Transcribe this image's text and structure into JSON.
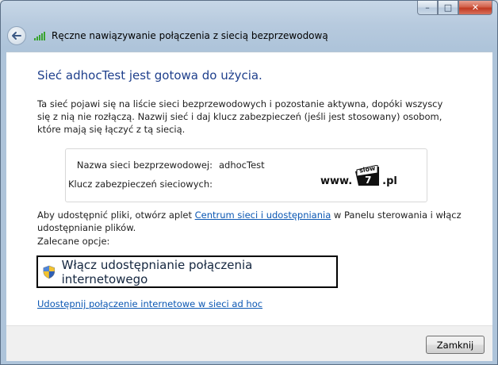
{
  "window": {
    "title": "Ręczne nawiązywanie połączenia z siecią bezprzewodową",
    "minimize_glyph": "–",
    "maximize_glyph": "□",
    "close_glyph": "✕"
  },
  "icons": {
    "back": "back-arrow-icon",
    "network": "wireless-signal-icon",
    "shield": "uac-shield-icon"
  },
  "main": {
    "heading": "Sieć adhocTest jest gotowa do użycia.",
    "description": "Ta sieć pojawi się na liście sieci bezprzewodowych i pozostanie aktywna, dopóki wszyscy się z nią nie rozłączą. Nazwij sieć i daj klucz zabezpieczeń (jeśli jest stosowany) osobom, które mają się łączyć z tą siecią.",
    "network_name_label": "Nazwa sieci bezprzewodowej:",
    "network_name_value": "adhocTest",
    "security_key_label": "Klucz zabezpieczeń sieciowych:",
    "security_key_value": "",
    "share_text_before": "Aby udostępnić pliki, otwórz aplet ",
    "share_link": "Centrum sieci i udostępniania",
    "share_text_after": " w Panelu sterowania i włącz udostępnianie plików.",
    "recommended_label": "Zalecane opcje:",
    "ics_option": "Włącz udostępnianie połączenia internetowego",
    "adhoc_link": "Udostępnij połączenie internetowe w sieci ad hoc"
  },
  "watermark": {
    "prefix": "www.",
    "logo_top": "slow",
    "logo_num": "7",
    "suffix": ".pl"
  },
  "footer": {
    "close_label": "Zamknij"
  }
}
